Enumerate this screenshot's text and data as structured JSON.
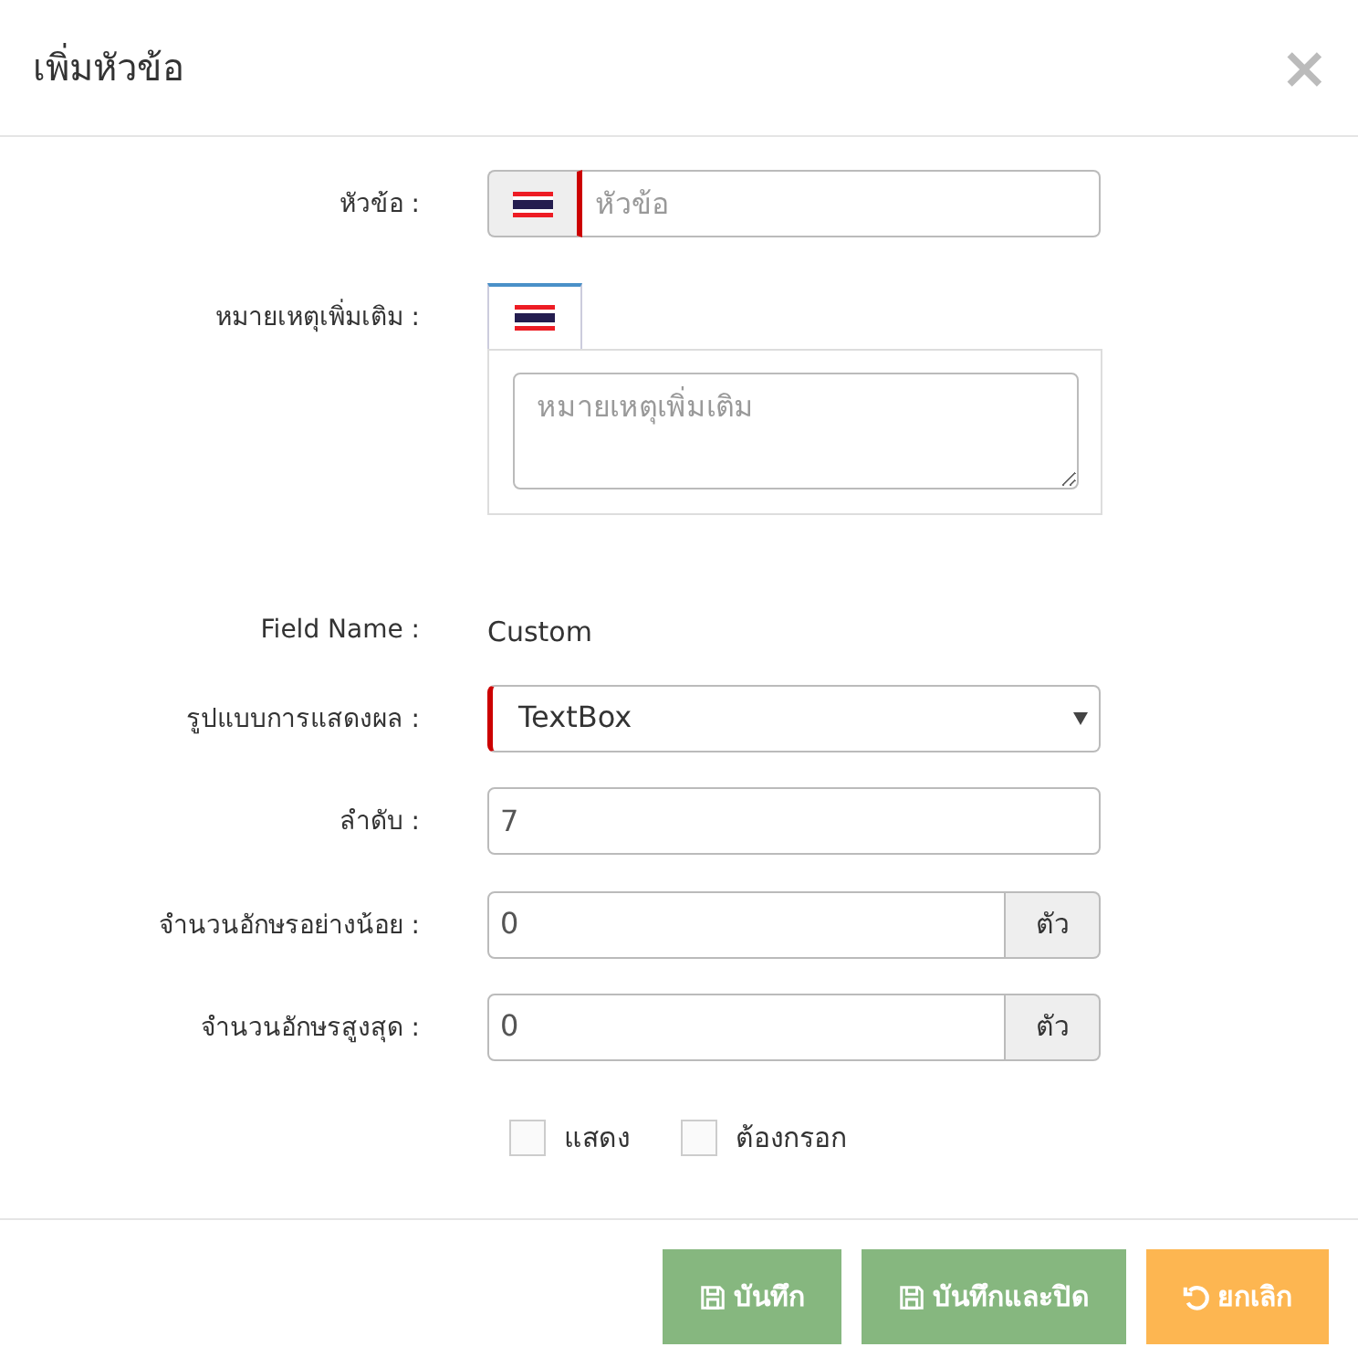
{
  "dialog": {
    "title": "เพิ่มหัวข้อ",
    "close": "×"
  },
  "fields": [
    {
      "kind": "flag-input",
      "label": "หัวข้อ :",
      "placeholder": "หัวข้อ",
      "required": true
    },
    {
      "kind": "flag-textarea",
      "label": "หมายเหตุเพิ่มเติม :",
      "placeholder": "หมายเหตุเพิ่มเติม",
      "tabs": [
        {
          "selected": true
        }
      ]
    },
    {
      "kind": "static",
      "label": "Field Name :",
      "value": "Custom"
    },
    {
      "kind": "select",
      "label": "รูปแบบการแสดงผล :",
      "value": "TextBox",
      "required": true
    },
    {
      "kind": "input",
      "label": "ลำดับ :",
      "value": "7"
    },
    {
      "kind": "addon-input",
      "label": "จำนวนอักษรอย่างน้อย :",
      "value": "0",
      "addon": "ตัว"
    },
    {
      "kind": "addon-input",
      "label": "จำนวนอักษรสูงสุด :",
      "value": "0",
      "addon": "ตัว"
    }
  ],
  "checkboxes": [
    {
      "label": "แสดง",
      "checked": false
    },
    {
      "label": "ต้องกรอก",
      "checked": false
    }
  ],
  "buttons": [
    {
      "label": "บันทึก",
      "kind": "save"
    },
    {
      "label": "บันทึกและปิด",
      "kind": "save"
    },
    {
      "label": "ยกเลิก",
      "kind": "cancel"
    }
  ]
}
